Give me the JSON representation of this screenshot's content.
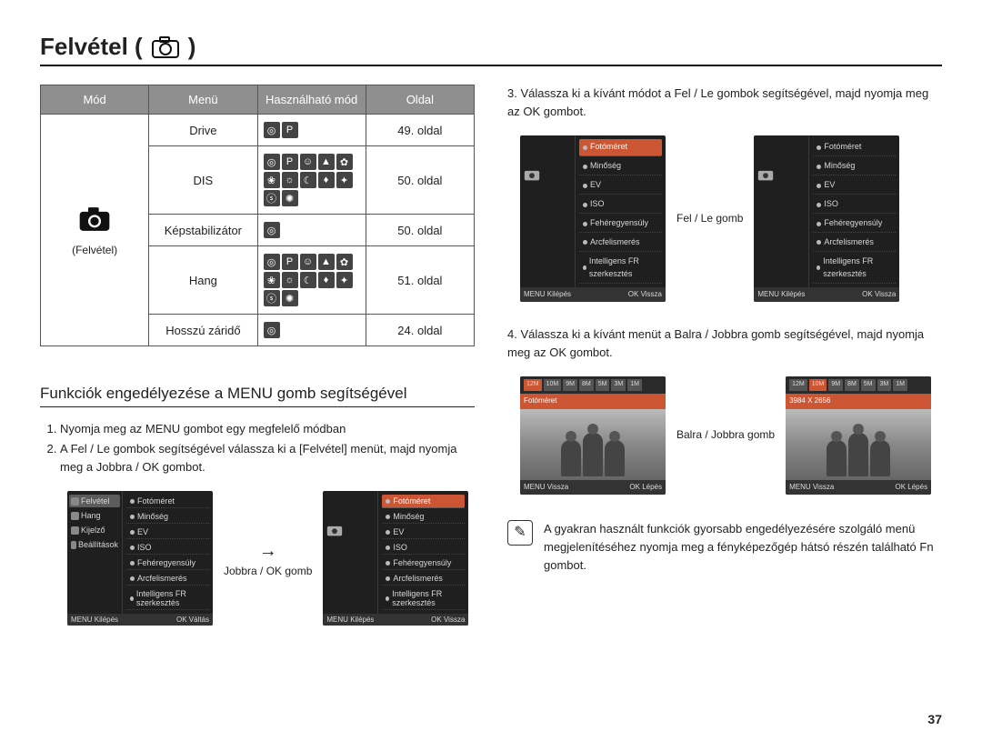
{
  "page_number": "37",
  "title": "Felvétel (",
  "title_icon_trail": ")",
  "table": {
    "headers": [
      "Mód",
      "Menü",
      "Használható mód",
      "Oldal"
    ],
    "mode_label": "(Felvétel)",
    "rows": [
      {
        "menu": "Drive",
        "icons": 2,
        "page": "49. oldal"
      },
      {
        "menu": "DIS",
        "icons": 12,
        "page": "50. oldal"
      },
      {
        "menu": "Képstabilizátor",
        "icons": 1,
        "page": "50. oldal"
      },
      {
        "menu": "Hang",
        "icons": 12,
        "page": "51. oldal"
      },
      {
        "menu": "Hosszú záridő",
        "icons": 1,
        "page": "24. oldal"
      }
    ]
  },
  "subsection": "Funkciók engedélyezése a MENU gomb segítségével",
  "steps_left": [
    "Nyomja meg az MENU gombot egy megfelelő módban",
    "A Fel / Le gombok segítségével válassza ki a [Felvétel] menüt, majd nyomja meg a Jobbra / OK gombot."
  ],
  "steps_right": [
    "Válassza ki a kívánt módot a Fel / Le gombok segítségével, majd nyomja meg az OK gombot.",
    "Válassza ki a kívánt menüt a Balra / Jobbra gomb segítségével, majd nyomja meg az OK gombot."
  ],
  "arrow_labels": {
    "jobbra_ok": "Jobbra / OK gomb",
    "fel_le": "Fel / Le gomb",
    "balra_jobbra": "Balra / Jobbra gomb"
  },
  "camera_menu": {
    "left_active": "Felvétel",
    "left_items": [
      "Felvétel",
      "Hang",
      "Kijelző",
      "Beállítások"
    ],
    "right_items": [
      "Fotóméret",
      "Minőség",
      "EV",
      "ISO",
      "Fehéregyensúly",
      "Arcfelismerés",
      "Intelligens FR szerkesztés"
    ],
    "right_active": "Fotóméret",
    "foot_left": "Kilépés",
    "foot_right_valtas": "Váltás",
    "foot_right_vissza": "Vissza",
    "foot_right_lepes": "Lépés",
    "menu_btn": "MENU",
    "ok_btn": "OK"
  },
  "photo_screen": {
    "chips": [
      "12M",
      "10M",
      "9M",
      "8M",
      "5M",
      "3M",
      "1M"
    ],
    "label_fotomeret": "Fotóméret",
    "label_dims": "3984 X 2656",
    "foot_left": "Vissza",
    "foot_right": "Lépés"
  },
  "note": "A gyakran használt funkciók gyorsabb engedélyezésére szolgáló menü megjelenítéséhez nyomja meg a fényképezőgép hátsó részén található Fn gombot."
}
